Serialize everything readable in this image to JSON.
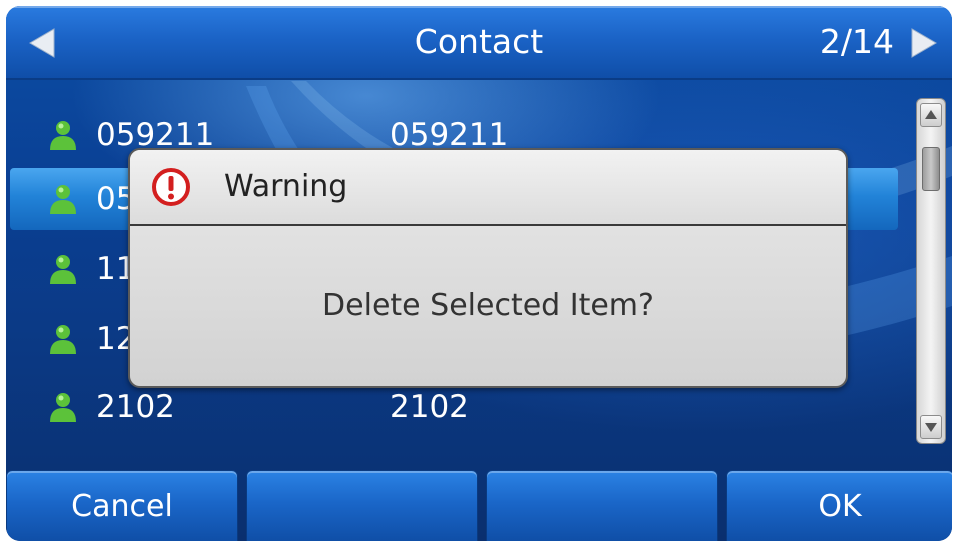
{
  "title_bar": {
    "title": "Contact",
    "page_indicator": "2/14"
  },
  "contacts": [
    {
      "name": "059211",
      "number": "059211",
      "selected": false
    },
    {
      "name": "05",
      "number": "",
      "selected": true
    },
    {
      "name": "11",
      "number": "",
      "selected": false
    },
    {
      "name": "12",
      "number": "",
      "selected": false
    },
    {
      "name": "2102",
      "number": "2102",
      "selected": false
    }
  ],
  "dialog": {
    "title": "Warning",
    "message": "Delete Selected Item?"
  },
  "softkeys": [
    "Cancel",
    "",
    "",
    "OK"
  ],
  "icons": {
    "contact": "person-icon",
    "warning": "warning-icon",
    "prev": "left-arrow-icon",
    "next": "right-arrow-icon"
  },
  "colors": {
    "screen_background": "#0b3a86",
    "title_bar": "#1b63c6",
    "selected_row": "#2283d8",
    "contact_icon": "#5cc23a",
    "warning_icon": "#d31f1f",
    "dialog_background": "#d9d9d9"
  }
}
